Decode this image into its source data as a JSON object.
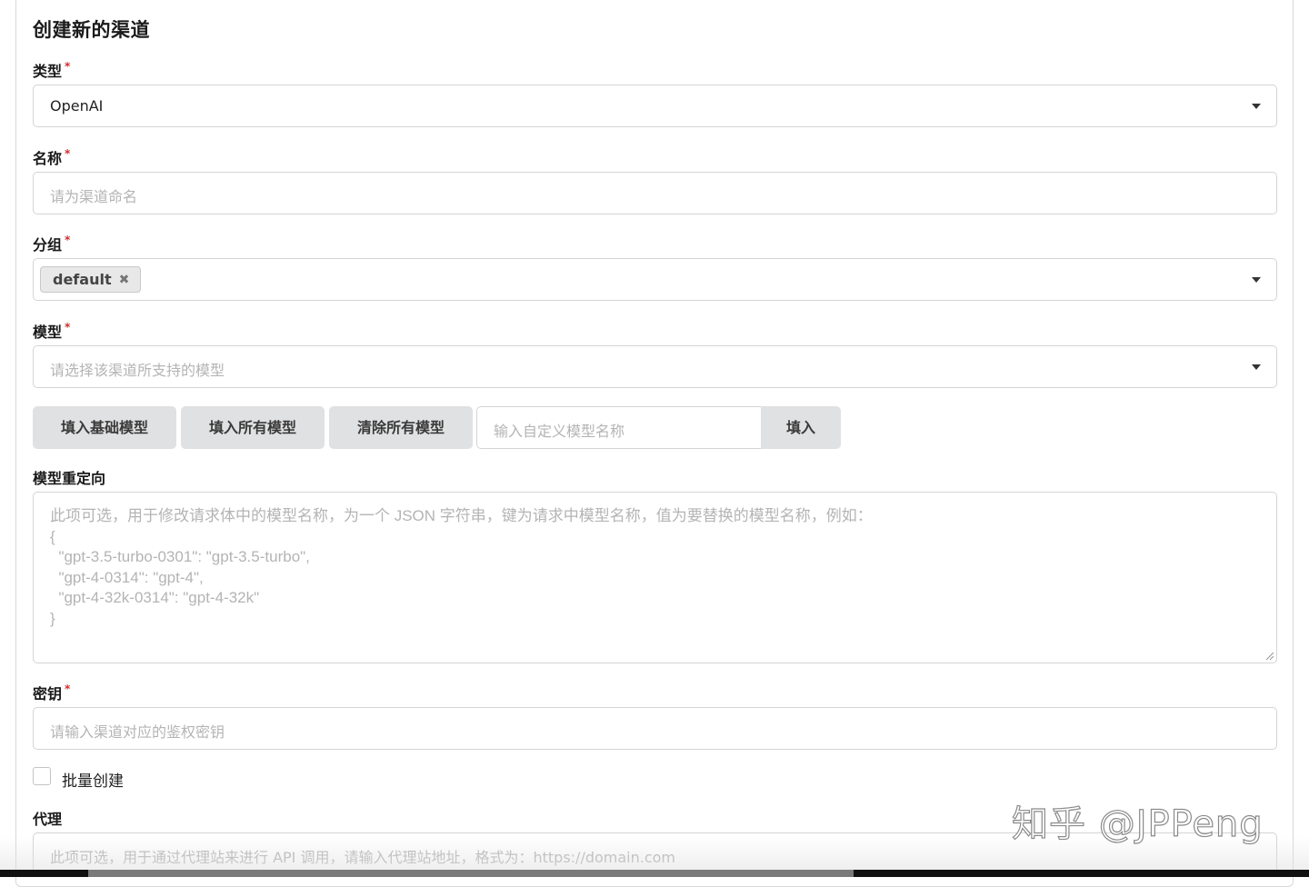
{
  "form": {
    "title": "创建新的渠道",
    "required_mark": "*",
    "type": {
      "label": "类型",
      "value": "OpenAI"
    },
    "name": {
      "label": "名称",
      "placeholder": "请为渠道命名"
    },
    "group": {
      "label": "分组",
      "chips": [
        "default"
      ],
      "remove_glyph": "✖"
    },
    "models": {
      "label": "模型",
      "placeholder": "请选择该渠道所支持的模型"
    },
    "model_buttons": {
      "fill_basic": "填入基础模型",
      "fill_all": "填入所有模型",
      "clear_all": "清除所有模型",
      "custom_placeholder": "输入自定义模型名称",
      "fill": "填入"
    },
    "model_mapping": {
      "label": "模型重定向",
      "placeholder": "此项可选，用于修改请求体中的模型名称，为一个 JSON 字符串，键为请求中模型名称，值为要替换的模型名称，例如：\n{\n  \"gpt-3.5-turbo-0301\": \"gpt-3.5-turbo\",\n  \"gpt-4-0314\": \"gpt-4\",\n  \"gpt-4-32k-0314\": \"gpt-4-32k\"\n}"
    },
    "key": {
      "label": "密钥",
      "placeholder": "请输入渠道对应的鉴权密钥"
    },
    "batch": {
      "label": "批量创建",
      "checked": false
    },
    "proxy": {
      "label": "代理",
      "placeholder": "此项可选，用于通过代理站来进行 API 调用，请输入代理站地址，格式为：https://domain.com"
    }
  },
  "watermark": "知乎 @JPPeng",
  "colors": {
    "required": "#db2828",
    "button_bg": "#e0e1e2",
    "placeholder": "#b4b4b4"
  }
}
